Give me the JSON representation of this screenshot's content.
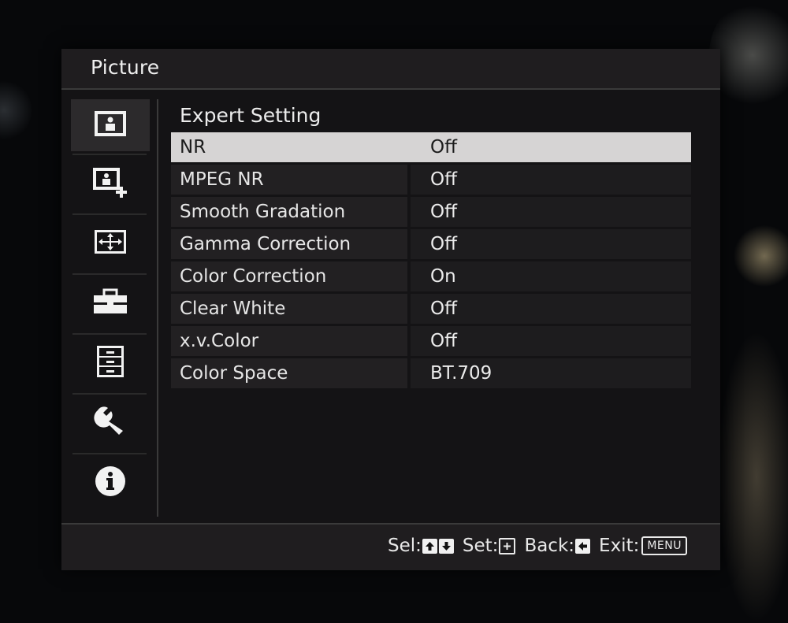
{
  "window": {
    "title": "Picture"
  },
  "sidebar": {
    "items": [
      {
        "icon": "picture-icon",
        "selected": true
      },
      {
        "icon": "picture-plus-icon",
        "selected": false
      },
      {
        "icon": "screen-adjust-icon",
        "selected": false
      },
      {
        "icon": "toolbox-icon",
        "selected": false
      },
      {
        "icon": "storage-icon",
        "selected": false
      },
      {
        "icon": "wrench-icon",
        "selected": false
      },
      {
        "icon": "info-icon",
        "selected": false
      }
    ]
  },
  "main": {
    "section_title": "Expert Setting",
    "rows": [
      {
        "label": "NR",
        "value": "Off",
        "highlighted": true
      },
      {
        "label": "MPEG NR",
        "value": "Off",
        "highlighted": false
      },
      {
        "label": "Smooth Gradation",
        "value": "Off",
        "highlighted": false
      },
      {
        "label": "Gamma Correction",
        "value": "Off",
        "highlighted": false
      },
      {
        "label": "Color Correction",
        "value": "On",
        "highlighted": false
      },
      {
        "label": "Clear White",
        "value": "Off",
        "highlighted": false
      },
      {
        "label": "x.v.Color",
        "value": "Off",
        "highlighted": false
      },
      {
        "label": "Color Space",
        "value": "BT.709",
        "highlighted": false
      }
    ]
  },
  "footer": {
    "sel_label": "Sel:",
    "set_label": "Set:",
    "back_label": "Back:",
    "exit_label": "Exit:",
    "menu_key": "MENU"
  },
  "colors": {
    "panel": "#141315",
    "highlight_row": "#d6d4d4",
    "row_label_bg": "#222022",
    "row_value_bg": "#1d1c1e"
  }
}
